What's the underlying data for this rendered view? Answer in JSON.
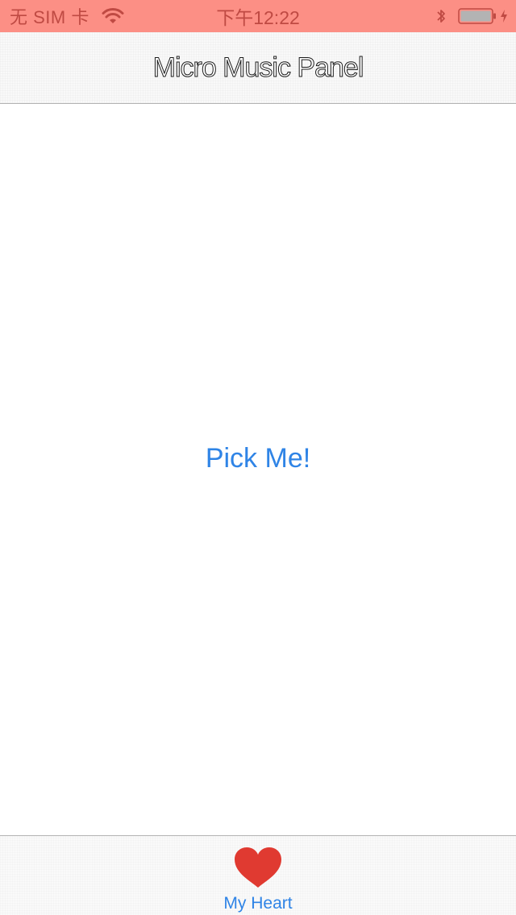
{
  "status_bar": {
    "carrier": "无 SIM 卡",
    "time": "下午12:22",
    "icons": [
      "wifi-icon",
      "bluetooth-icon",
      "battery-icon",
      "charging-bolt-icon"
    ],
    "colors": {
      "background": "#fc8f85",
      "foreground": "#bf4a43"
    }
  },
  "nav_bar": {
    "title": "Micro Music Panel"
  },
  "main": {
    "pick_button_label": "Pick Me!",
    "accent_color": "#2f84e6"
  },
  "tab_bar": {
    "items": [
      {
        "label": "My Heart",
        "icon": "heart-icon",
        "icon_color": "#e03a31",
        "selected": true
      }
    ]
  }
}
